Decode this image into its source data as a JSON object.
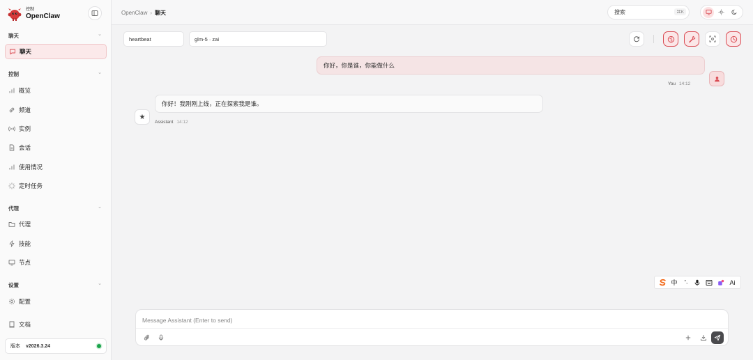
{
  "brand": {
    "subtitle": "控制",
    "title": "OpenClaw"
  },
  "sidebar": {
    "sections": [
      {
        "label": "聊天"
      },
      {
        "label": "控制"
      },
      {
        "label": "代理"
      },
      {
        "label": "设置"
      }
    ],
    "items": [
      {
        "label": "聊天",
        "icon": "chat-icon"
      },
      {
        "label": "概览",
        "icon": "bar-chart-icon"
      },
      {
        "label": "频道",
        "icon": "link-icon"
      },
      {
        "label": "实例",
        "icon": "broadcast-icon"
      },
      {
        "label": "会话",
        "icon": "document-icon"
      },
      {
        "label": "使用情况",
        "icon": "bar-chart-icon"
      },
      {
        "label": "定时任务",
        "icon": "loader-icon"
      },
      {
        "label": "代理",
        "icon": "folder-icon"
      },
      {
        "label": "技能",
        "icon": "bolt-icon"
      },
      {
        "label": "节点",
        "icon": "monitor-icon"
      },
      {
        "label": "配置",
        "icon": "gear-icon"
      },
      {
        "label": "文档",
        "icon": "book-icon"
      }
    ],
    "version": {
      "label": "版本",
      "value": "v2026.3.24"
    }
  },
  "topbar": {
    "breadcrumb": {
      "root": "OpenClaw",
      "separator": "›",
      "current": "聊天"
    },
    "search": {
      "placeholder": "搜索",
      "shortcut": "⌘K"
    }
  },
  "session": {
    "name": "heartbeat",
    "model": "glm-5 · zai"
  },
  "messages": [
    {
      "role": "user",
      "text": "你好，你是谁，你能做什么",
      "author": "You",
      "time": "14:12"
    },
    {
      "role": "assistant",
      "text": "你好！我刚刚上线，正在探索我是谁。",
      "author": "Assistant",
      "time": "14:12"
    }
  ],
  "composer": {
    "placeholder": "Message Assistant (Enter to send)"
  },
  "ime": {
    "mode": "中",
    "punct": "°,",
    "ai": "Ai"
  },
  "colors": {
    "accent": "#d94a52",
    "accent_bg": "#fbe7e8",
    "status_online": "#1aa34a"
  }
}
